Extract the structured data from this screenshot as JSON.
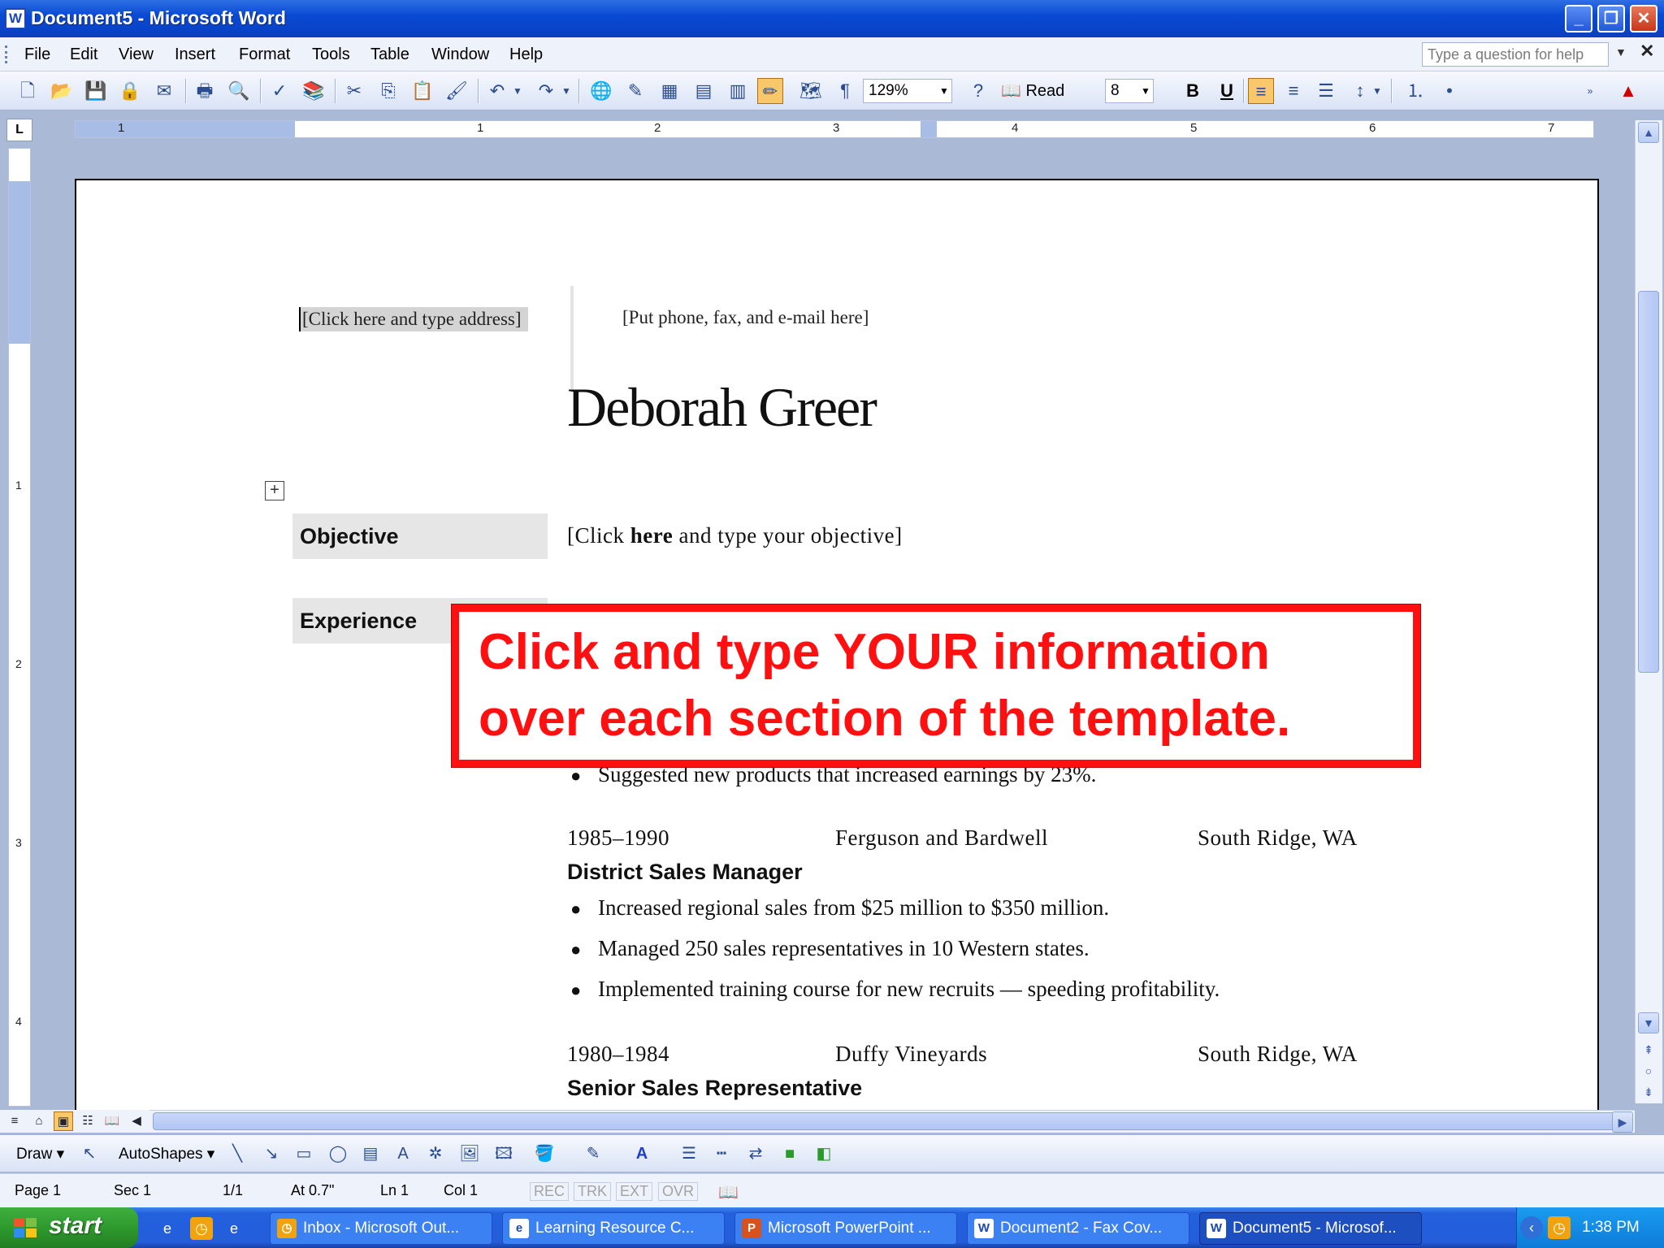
{
  "window": {
    "title": "Document5 - Microsoft Word",
    "app_icon": "W"
  },
  "menu": {
    "items": [
      "File",
      "Edit",
      "View",
      "Insert",
      "Format",
      "Tools",
      "Table",
      "Window",
      "Help"
    ],
    "ask_placeholder": "Type a question for help"
  },
  "toolbar": {
    "zoom": "129%",
    "read_label": "Read",
    "font_size": "8",
    "bold_label": "B",
    "underline_label": "U"
  },
  "ruler": {
    "numbers": [
      "1",
      "1",
      "2",
      "3",
      "4",
      "5",
      "6",
      "7"
    ],
    "vertical_numbers": [
      "1",
      "2",
      "3",
      "4"
    ]
  },
  "document": {
    "address_placeholder": "[Click here and type address]",
    "contact_placeholder": "[Put phone, fax, and e-mail here]",
    "name": "Deborah Greer",
    "objective_label": "Objective",
    "objective_text_a": "[Click ",
    "objective_text_b": "here",
    "objective_text_c": " and type your objective]",
    "experience_label": "Experience",
    "bullet_partial": "Suggested new products that increased earnings by 23%.",
    "job2": {
      "dates": "1985–1990",
      "company": "Ferguson and Bardwell",
      "location": "South Ridge, WA",
      "title": "District Sales Manager",
      "bullets": [
        "Increased regional sales from $25 million to $350 million.",
        "Managed 250 sales representatives in 10 Western states.",
        "Implemented training course for new recruits — speeding profitability."
      ]
    },
    "job3": {
      "dates": "1980–1984",
      "company": "Duffy Vineyards",
      "location": "South Ridge, WA",
      "title": "Senior Sales Representative"
    }
  },
  "callout": {
    "line1": "Click and type YOUR information",
    "line2": "over each section of the template."
  },
  "drawing_toolbar": {
    "draw_label": "Draw",
    "autoshapes_label": "AutoShapes"
  },
  "status": {
    "page": "Page  1",
    "sec": "Sec  1",
    "pages": "1/1",
    "at": "At  0.7\"",
    "ln": "Ln  1",
    "col": "Col  1",
    "rec": "REC",
    "trk": "TRK",
    "ext": "EXT",
    "ovr": "OVR"
  },
  "taskbar": {
    "start_label": "start",
    "tasks": [
      "Inbox - Microsoft Out...",
      "Learning Resource C...",
      "Microsoft PowerPoint ...",
      "Document2 - Fax Cov...",
      "Document5 - Microsof..."
    ],
    "time": "1:38 PM"
  },
  "colors": {
    "callout": "#ff1010",
    "title_bar": "#0a4ad4",
    "taskbar": "#245edb",
    "start_button": "#2e9a2e"
  }
}
